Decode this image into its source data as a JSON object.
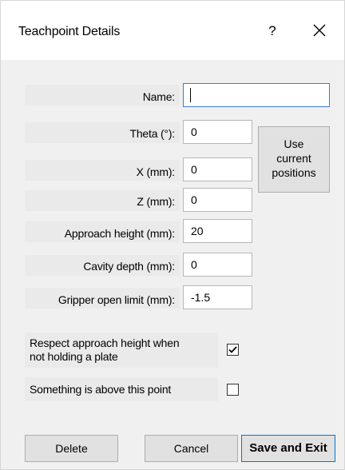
{
  "window": {
    "title": "Teachpoint Details",
    "help": "?"
  },
  "fields": [
    {
      "id": "name",
      "label": "Name:",
      "value": ""
    },
    {
      "id": "theta",
      "label": "Theta (°):",
      "value": "0"
    },
    {
      "id": "x",
      "label": "X (mm):",
      "value": "0"
    },
    {
      "id": "z",
      "label": "Z (mm):",
      "value": "0"
    },
    {
      "id": "approach",
      "label": "Approach height (mm):",
      "value": "20"
    },
    {
      "id": "cavity",
      "label": "Cavity depth (mm):",
      "value": "0"
    },
    {
      "id": "gripper",
      "label": "Gripper open limit (mm):",
      "value": "-1.5"
    }
  ],
  "use_current": {
    "line1": "Use",
    "line2": "current",
    "line3": "positions"
  },
  "checkboxes": [
    {
      "line1": "Respect approach height when",
      "line2": "not holding a plate",
      "checked": true
    },
    {
      "line1": "Something is above this point",
      "checked": false
    }
  ],
  "buttons": {
    "delete": "Delete",
    "cancel": "Cancel",
    "save": "Save and Exit"
  }
}
